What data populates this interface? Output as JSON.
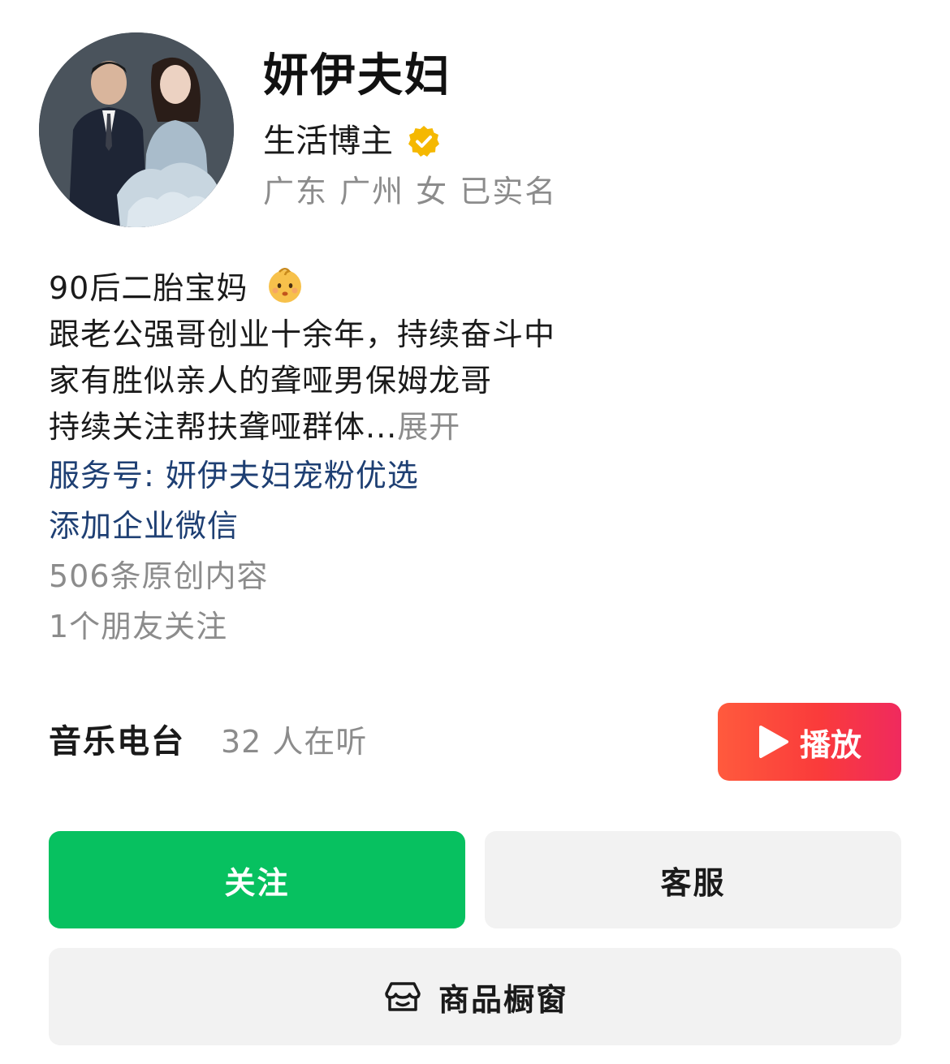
{
  "profile": {
    "name": "妍伊夫妇",
    "category": "生活博主",
    "location": "广东 广州 女 已实名"
  },
  "bio": {
    "line1": "90后二胎宝妈",
    "line2": "跟老公强哥创业十余年，持续奋斗中",
    "line3": "家有胜似亲人的聋哑男保姆龙哥",
    "line4": "持续关注帮扶聋哑群体...",
    "expand_label": "展开",
    "service_link": "服务号: 妍伊夫妇宠粉优选",
    "wechat_link": "添加企业微信",
    "original_count": "506条原创内容",
    "friends_following": "1个朋友关注"
  },
  "radio": {
    "title": "音乐电台",
    "listeners": "32 人在听",
    "play_label": "播放"
  },
  "actions": {
    "follow_label": "关注",
    "service_label": "客服",
    "shop_label": "商品橱窗"
  },
  "colors": {
    "follow_green": "#07c160",
    "link_blue": "#1e3f73",
    "verified_gold": "#f5b800",
    "play_red": "#fa3b3b"
  },
  "icons": {
    "verified": "verified-badge-icon",
    "baby": "baby-emoji-icon",
    "play": "play-icon",
    "shop": "shop-window-icon"
  }
}
